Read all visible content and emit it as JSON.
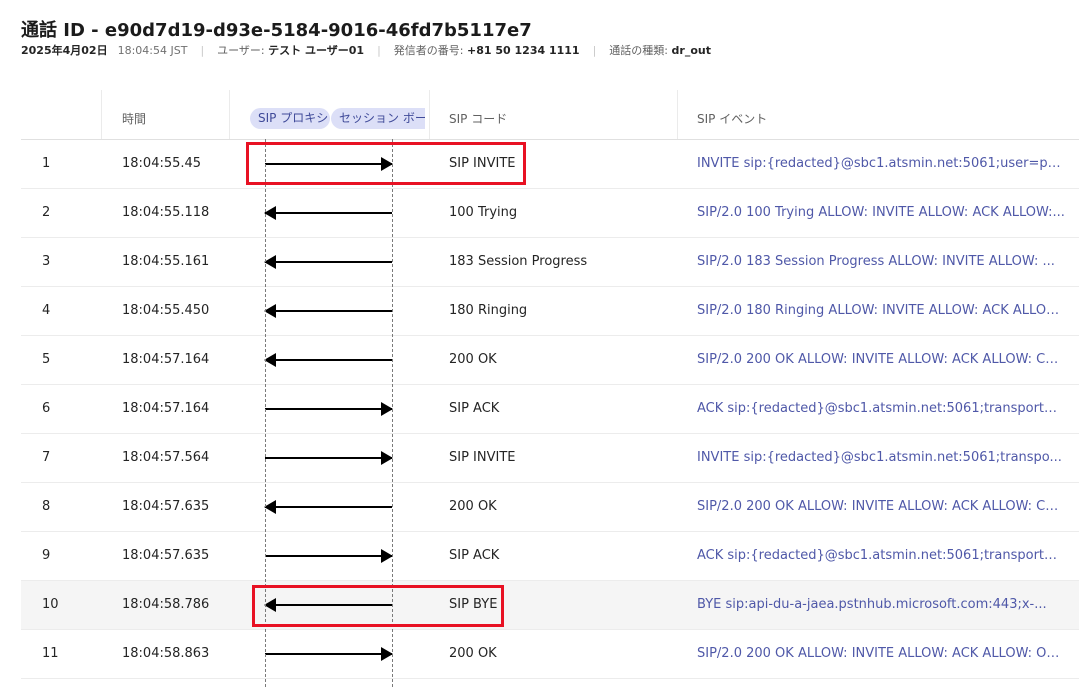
{
  "header": {
    "title": "通話 ID - e90d7d19-d93e-5184-9016-46fd7b5117e7",
    "date": "2025年4月02日",
    "time": "18:04:54 JST",
    "user_label": "ユーザー:",
    "user_value": "テスト ユーザー01",
    "caller_label": "発信者の番号:",
    "caller_value": "+81 50 1234 1111",
    "calltype_label": "通話の種類:",
    "calltype_value": "dr_out"
  },
  "columns": {
    "time": "時間",
    "proxy": "SIP プロキシ",
    "session": "セッション ボーダー コントローラー",
    "code": "SIP コード",
    "event": "SIP イベント"
  },
  "rows": [
    {
      "num": "1",
      "time": "18:04:55.45",
      "direction": "right",
      "code": "SIP INVITE",
      "event": "INVITE sip:{redacted}@sbc1.atsmin.net:5061;user=ph..."
    },
    {
      "num": "2",
      "time": "18:04:55.118",
      "direction": "left",
      "code": "100 Trying",
      "event": "SIP/2.0 100 Trying ALLOW: INVITE ALLOW: ACK ALLOW:..."
    },
    {
      "num": "3",
      "time": "18:04:55.161",
      "direction": "left",
      "code": "183 Session Progress",
      "event": "SIP/2.0 183 Session Progress ALLOW: INVITE ALLOW: ..."
    },
    {
      "num": "4",
      "time": "18:04:55.450",
      "direction": "left",
      "code": "180 Ringing",
      "event": "SIP/2.0 180 Ringing ALLOW: INVITE ALLOW: ACK ALLOW..."
    },
    {
      "num": "5",
      "time": "18:04:57.164",
      "direction": "left",
      "code": "200 OK",
      "event": "SIP/2.0 200 OK ALLOW: INVITE ALLOW: ACK ALLOW: CAN..."
    },
    {
      "num": "6",
      "time": "18:04:57.164",
      "direction": "right",
      "code": "SIP ACK",
      "event": "ACK sip:{redacted}@sbc1.atsmin.net:5061;transport=..."
    },
    {
      "num": "7",
      "time": "18:04:57.564",
      "direction": "right",
      "code": "SIP INVITE",
      "event": "INVITE sip:{redacted}@sbc1.atsmin.net:5061;transpo..."
    },
    {
      "num": "8",
      "time": "18:04:57.635",
      "direction": "left",
      "code": "200 OK",
      "event": "SIP/2.0 200 OK ALLOW: INVITE ALLOW: ACK ALLOW: CAN..."
    },
    {
      "num": "9",
      "time": "18:04:57.635",
      "direction": "right",
      "code": "SIP ACK",
      "event": "ACK sip:{redacted}@sbc1.atsmin.net:5061;transport=..."
    },
    {
      "num": "10",
      "time": "18:04:58.786",
      "direction": "left",
      "code": "SIP BYE",
      "event": "BYE sip:api-du-a-jaea.pstnhub.microsoft.com:443;x-..."
    },
    {
      "num": "11",
      "time": "18:04:58.863",
      "direction": "right",
      "code": "200 OK",
      "event": "SIP/2.0 200 OK ALLOW: INVITE ALLOW: ACK ALLOW: OPT..."
    }
  ],
  "selected_row": "10",
  "highlight_color": "#e81123"
}
